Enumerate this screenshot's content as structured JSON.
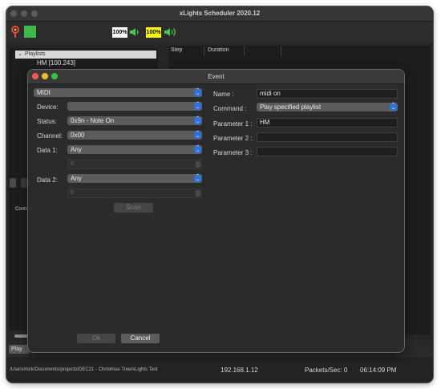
{
  "app": {
    "title": "xLights Scheduler 2020.12",
    "volume_master": "100%",
    "volume_secondary": "100%"
  },
  "left": {
    "tree_header": "Playlists",
    "tree_item": "HM [100.243]",
    "side_label": "Contr"
  },
  "schedule_table": {
    "columns": [
      "Step",
      "Duration"
    ]
  },
  "bottom": {
    "play_button": "Play",
    "path": "/Users/nick/Documents/projects/DEC21 - Christmas Tree/xLights Test",
    "ip": "192.168.1.12",
    "packets": "Packets/Sec: 0",
    "time": "06:14:09 PM"
  },
  "dialog": {
    "title": "Event",
    "event_type": "MIDI",
    "device_label": "Device:",
    "device_value": "",
    "status_label": "Status:",
    "status_value": "0x9n - Note On",
    "channel_label": "Channel:",
    "channel_value": "0x00",
    "data1_label": "Data 1:",
    "data1_value": "Any",
    "data1_spin": "0",
    "data2_label": "Data 2:",
    "data2_value": "Any",
    "data2_spin": "0",
    "scan_button": "Scan",
    "name_label": "Name :",
    "name_value": "midi on",
    "command_label": "Command :",
    "command_value": "Play specified playlist",
    "p1_label": "Parameter 1 :",
    "p1_value": "HM",
    "p2_label": "Parameter 2 :",
    "p2_value": "",
    "p3_label": "Parameter 3 :",
    "p3_value": "",
    "ok_button": "Ok",
    "cancel_button": "Cancel"
  },
  "colors": {
    "accent_blue": "#2f72d8",
    "volume_white": "#ffffff",
    "volume_yellow": "#ffff00",
    "toolbar_green": "#3dba4a"
  }
}
